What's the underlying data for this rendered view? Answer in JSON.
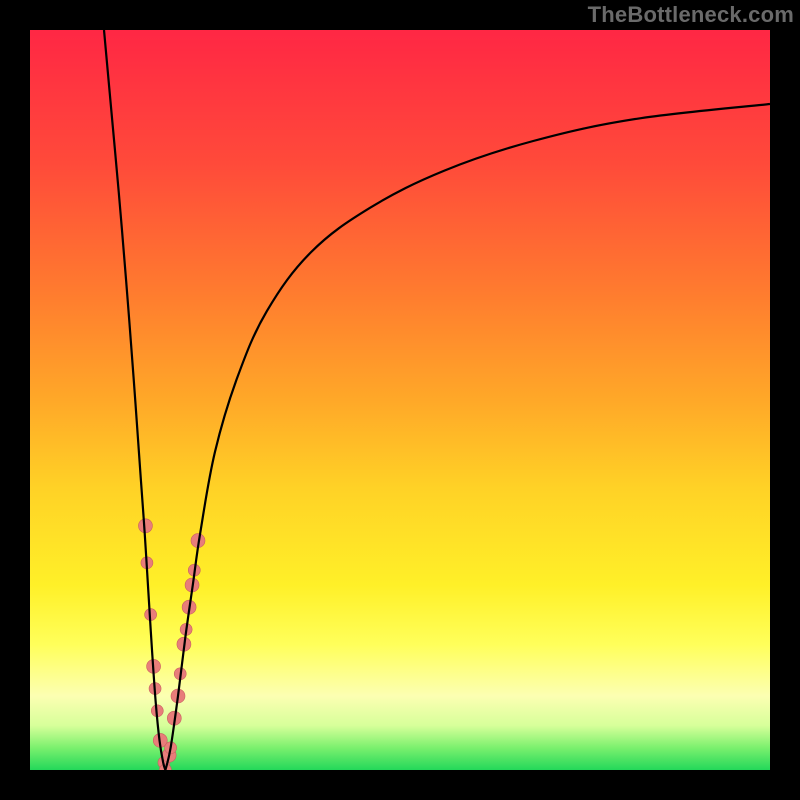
{
  "watermark": "TheBottleneck.com",
  "colors": {
    "gradient_top": "#ff2744",
    "gradient_bottom": "#23d85a",
    "curve": "#000000",
    "dot_fill": "#e87d7a",
    "dot_stroke": "#c96060",
    "frame": "#000000"
  },
  "chart_data": {
    "type": "line",
    "title": "",
    "xlabel": "",
    "ylabel": "",
    "xlim": [
      0,
      100
    ],
    "ylim": [
      0,
      100
    ],
    "grid": false,
    "series": [
      {
        "name": "left-falling-branch",
        "x": [
          10,
          11,
          12,
          13,
          14,
          15,
          15.5,
          16,
          16.5,
          17,
          17.5,
          18,
          18.3
        ],
        "y": [
          100,
          89,
          78,
          66,
          53,
          39,
          32,
          24,
          16,
          9,
          4,
          1,
          0
        ]
      },
      {
        "name": "right-rising-branch",
        "x": [
          18.3,
          19,
          20,
          21,
          22,
          23,
          25,
          28,
          32,
          38,
          46,
          56,
          68,
          82,
          100
        ],
        "y": [
          0,
          3,
          10,
          18,
          25,
          32,
          43,
          53,
          62,
          70,
          76,
          81,
          85,
          88,
          90
        ]
      }
    ],
    "scatter": [
      {
        "x": 15.6,
        "y": 33,
        "r": 7
      },
      {
        "x": 15.8,
        "y": 28,
        "r": 6
      },
      {
        "x": 16.3,
        "y": 21,
        "r": 6
      },
      {
        "x": 16.7,
        "y": 14,
        "r": 7
      },
      {
        "x": 16.9,
        "y": 11,
        "r": 6
      },
      {
        "x": 17.2,
        "y": 8,
        "r": 6
      },
      {
        "x": 17.6,
        "y": 4,
        "r": 7
      },
      {
        "x": 18.1,
        "y": 1,
        "r": 6
      },
      {
        "x": 18.3,
        "y": 0,
        "r": 6
      },
      {
        "x": 18.8,
        "y": 2,
        "r": 7
      },
      {
        "x": 19.0,
        "y": 3,
        "r": 6
      },
      {
        "x": 19.5,
        "y": 7,
        "r": 7
      },
      {
        "x": 20.0,
        "y": 10,
        "r": 7
      },
      {
        "x": 20.3,
        "y": 13,
        "r": 6
      },
      {
        "x": 20.8,
        "y": 17,
        "r": 7
      },
      {
        "x": 21.1,
        "y": 19,
        "r": 6
      },
      {
        "x": 21.5,
        "y": 22,
        "r": 7
      },
      {
        "x": 21.9,
        "y": 25,
        "r": 7
      },
      {
        "x": 22.2,
        "y": 27,
        "r": 6
      },
      {
        "x": 22.7,
        "y": 31,
        "r": 7
      }
    ]
  }
}
